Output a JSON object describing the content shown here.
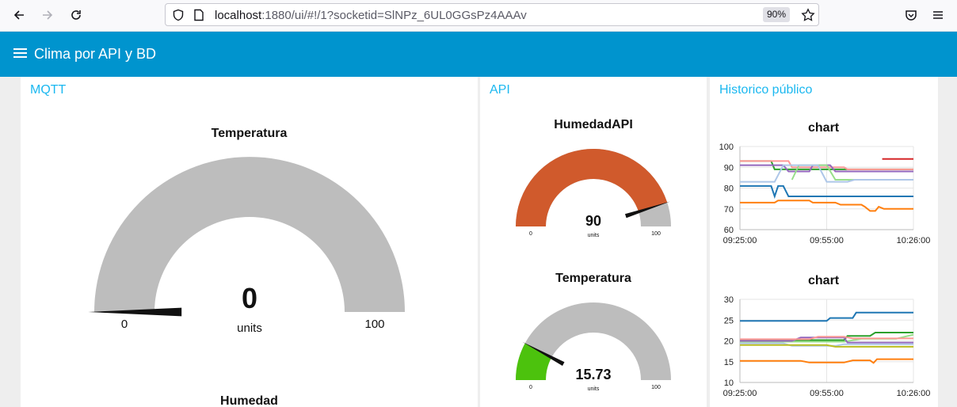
{
  "browser": {
    "url_host": "localhost",
    "url_rest": ":1880/ui/#!/1?socketid=SlNPz_6UL0GGsPz4AAAv",
    "zoom": "90%"
  },
  "app": {
    "title": "Clima por API y BD"
  },
  "groups": {
    "mqtt": {
      "title": "MQTT",
      "gauge_temperatura": {
        "label": "Temperatura",
        "value": "0",
        "units": "units",
        "min": "0",
        "max": "100",
        "fraction": 0.0,
        "color": "#bdbdbd"
      },
      "humedad_label": "Humedad"
    },
    "api": {
      "title": "API",
      "gauge_humedad": {
        "label": "HumedadAPI",
        "value": "90",
        "units": "units",
        "min": "0",
        "max": "100",
        "fraction": 0.9,
        "color": "#d05a2c"
      },
      "gauge_temperatura": {
        "label": "Temperatura",
        "value": "15.73",
        "units": "units",
        "min": "0",
        "max": "100",
        "fraction": 0.1573,
        "color": "#4cc20d"
      }
    },
    "historico": {
      "title": "Historico público",
      "chart1_title": "chart",
      "chart2_title": "chart"
    }
  },
  "chart_data": [
    {
      "type": "line",
      "title": "chart",
      "x_ticks": [
        "09:25:00",
        "09:55:00",
        "10:26:00"
      ],
      "y_ticks": [
        "100",
        "90",
        "80",
        "70",
        "60"
      ],
      "ylim": [
        60,
        100
      ],
      "grid": true,
      "series": [
        {
          "color": "#d62728",
          "points": [
            [
              0.82,
              94
            ],
            [
              1.0,
              94
            ]
          ]
        },
        {
          "color": "#2ca02c",
          "points": [
            [
              0.0,
              93
            ],
            [
              0.18,
              93
            ],
            [
              0.2,
              89
            ],
            [
              1.0,
              89
            ]
          ]
        },
        {
          "color": "#ff9896",
          "points": [
            [
              0.0,
              93
            ],
            [
              0.28,
              93
            ],
            [
              0.3,
              90
            ],
            [
              0.6,
              90
            ],
            [
              0.62,
              89
            ],
            [
              1.0,
              89
            ]
          ]
        },
        {
          "color": "#9467bd",
          "points": [
            [
              0.0,
              91
            ],
            [
              0.25,
              91
            ],
            [
              0.28,
              88
            ],
            [
              0.4,
              88
            ],
            [
              0.42,
              91
            ],
            [
              0.52,
              91
            ],
            [
              0.55,
              88
            ],
            [
              1.0,
              88
            ]
          ]
        },
        {
          "color": "#98df8a",
          "points": [
            [
              0.3,
              84
            ],
            [
              0.34,
              91
            ],
            [
              0.5,
              91
            ],
            [
              0.55,
              84
            ],
            [
              1.0,
              84
            ]
          ]
        },
        {
          "color": "#aec7e8",
          "points": [
            [
              0.0,
              83
            ],
            [
              0.2,
              83
            ],
            [
              0.25,
              91
            ],
            [
              0.45,
              91
            ],
            [
              0.5,
              83
            ],
            [
              0.62,
              83
            ],
            [
              0.66,
              84
            ],
            [
              1.0,
              84
            ]
          ]
        },
        {
          "color": "#1f77b4",
          "points": [
            [
              0.0,
              81
            ],
            [
              0.18,
              81
            ],
            [
              0.2,
              76
            ],
            [
              0.22,
              81
            ],
            [
              0.25,
              81
            ],
            [
              0.28,
              76
            ],
            [
              1.0,
              76
            ]
          ]
        },
        {
          "color": "#ff7f0e",
          "points": [
            [
              0.0,
              73
            ],
            [
              0.2,
              73
            ],
            [
              0.22,
              74
            ],
            [
              0.4,
              74
            ],
            [
              0.42,
              73
            ],
            [
              0.55,
              73
            ],
            [
              0.58,
              72
            ],
            [
              0.7,
              72
            ],
            [
              0.72,
              71
            ],
            [
              0.75,
              69
            ],
            [
              0.78,
              69
            ],
            [
              0.8,
              71
            ],
            [
              0.83,
              70
            ],
            [
              1.0,
              70
            ]
          ]
        }
      ]
    },
    {
      "type": "line",
      "title": "chart",
      "x_ticks": [
        "09:25:00",
        "09:55:00",
        "10:26:00"
      ],
      "y_ticks": [
        "30",
        "25",
        "20",
        "15",
        "10"
      ],
      "ylim": [
        10,
        30
      ],
      "grid": true,
      "series": [
        {
          "color": "#1f77b4",
          "points": [
            [
              0.0,
              24.8
            ],
            [
              0.5,
              24.8
            ],
            [
              0.52,
              25.5
            ],
            [
              0.65,
              25.5
            ],
            [
              0.67,
              26.8
            ],
            [
              1.0,
              26.8
            ]
          ]
        },
        {
          "color": "#2ca02c",
          "points": [
            [
              0.0,
              20.2
            ],
            [
              0.6,
              20.2
            ],
            [
              0.62,
              21.2
            ],
            [
              0.75,
              21.2
            ],
            [
              0.78,
              22
            ],
            [
              1.0,
              22
            ]
          ]
        },
        {
          "color": "#98df8a",
          "points": [
            [
              0.0,
              19.8
            ],
            [
              0.6,
              19.8
            ],
            [
              0.7,
              20.5
            ],
            [
              0.9,
              20.5
            ],
            [
              1.0,
              21.5
            ]
          ]
        },
        {
          "color": "#9467bd",
          "points": [
            [
              0.0,
              20
            ],
            [
              0.3,
              20
            ],
            [
              0.35,
              20.8
            ],
            [
              0.6,
              20.8
            ],
            [
              0.62,
              19.6
            ],
            [
              1.0,
              19.6
            ]
          ]
        },
        {
          "color": "#ff9896",
          "points": [
            [
              0.0,
              20.4
            ],
            [
              0.4,
              20.4
            ],
            [
              0.45,
              21
            ],
            [
              0.6,
              21
            ],
            [
              0.65,
              20.6
            ],
            [
              1.0,
              20.6
            ]
          ]
        },
        {
          "color": "#aec7e8",
          "points": [
            [
              0.0,
              19.4
            ],
            [
              0.25,
              19.4
            ],
            [
              0.3,
              18.8
            ],
            [
              0.55,
              18.8
            ],
            [
              0.6,
              19.2
            ],
            [
              1.0,
              19.2
            ]
          ]
        },
        {
          "color": "#bcbd22",
          "points": [
            [
              0.0,
              19.0
            ],
            [
              0.5,
              19.0
            ],
            [
              0.55,
              18.6
            ],
            [
              1.0,
              18.6
            ]
          ]
        },
        {
          "color": "#ff7f0e",
          "points": [
            [
              0.0,
              15.2
            ],
            [
              0.35,
              15.2
            ],
            [
              0.4,
              14.8
            ],
            [
              0.6,
              14.8
            ],
            [
              0.65,
              15.3
            ],
            [
              0.75,
              15.3
            ],
            [
              0.77,
              14.7
            ],
            [
              0.79,
              15.6
            ],
            [
              1.0,
              15.6
            ]
          ]
        }
      ]
    }
  ]
}
